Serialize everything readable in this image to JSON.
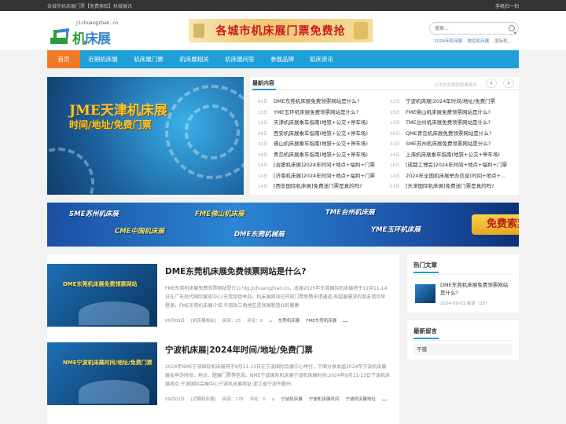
{
  "topbar": {
    "notice": "各城市机床展门票【免费索取】机械展讯",
    "mobile": "手机扫一扫"
  },
  "header": {
    "logo_domain": "jichuangzhan.cn",
    "logo_first": "机",
    "logo_rest": "床展网",
    "banner_text": "各城市机床展门票免费抢",
    "search_placeholder": "搜索...",
    "hotwords": [
      "2024年机床展",
      "数控机床展",
      "国际机..."
    ]
  },
  "nav": {
    "items": [
      "首页",
      "近期机床展",
      "机床展门票",
      "机床展相关",
      "机床展问答",
      "参展品牌",
      "机床资讯"
    ]
  },
  "slider": {
    "line1": "JME天津机床展",
    "line2": "时间/地址/免费门票"
  },
  "latest": {
    "title": "最新内容",
    "tip": "点击左右按钮查看更多",
    "prev": "‹",
    "next": "›",
    "left": [
      {
        "date": "03日",
        "title": "DME东莞机床展免费领票网站是什么?"
      },
      {
        "date": "13日",
        "title": "YME玉环机床展免费领票网站是什么?"
      },
      {
        "date": "13日",
        "title": "天津机床展乘车指南(地铁+公交+停车场)"
      },
      {
        "date": "06日",
        "title": "西安机床展乘车指南(地铁+公交+停车场)"
      },
      {
        "date": "31日",
        "title": "佛山机床展乘车指南(地铁+公交+停车场)"
      },
      {
        "date": "24日",
        "title": "青岛机床展乘车指南(地铁+公交+停车场)"
      },
      {
        "date": "16日",
        "title": "[合肥机床展]2024年时间+地点+福利+门票"
      },
      {
        "date": "14日",
        "title": "[济南机床展]2024年时间+地点+福利+门票"
      },
      {
        "date": "14日",
        "title": "[西安国际机床展]免费送门票是真的吗?"
      }
    ],
    "right": [
      {
        "date": "02日",
        "title": "宁波机床展|2024年时间/地址/免费门票"
      },
      {
        "date": "15日",
        "title": "FME佛山机床展免费领票网站是什么?"
      },
      {
        "date": "13日",
        "title": "TME台州机床展免费领票网站是什么?"
      },
      {
        "date": "06日",
        "title": "QME青岛机床展免费领票网站是什么?"
      },
      {
        "date": "31日",
        "title": "SME苏州机床展免费领票网站是什么?"
      },
      {
        "date": "24日",
        "title": "上海机床展乘车指南(地铁+公交+停车场)"
      },
      {
        "date": "16日",
        "title": "[成都工博会]2024年时间+地点+福利+门票"
      },
      {
        "date": "14日",
        "title": "2024年全国机床展举办信息(时间+地点+..."
      },
      {
        "date": "01日",
        "title": "[天津国际机床展]免费送门票是真的吗?"
      }
    ]
  },
  "ad2": {
    "texts": [
      "SME苏州机床展",
      "FME佛山机床展",
      "TME台州机床展",
      "CME中国机床展",
      "DME东莞机械展",
      "YME玉环机床展"
    ],
    "button": "免费索票"
  },
  "posts": [
    {
      "thumb_caption": "DME东莞机床展免费领票网站",
      "title": "DME东莞机床展免费领票网站是什么?",
      "excerpt": "FME东莞机床展免费领票网站是什么?dg.jichuangzhan.cn。本届2025年东莞国际机床展将于11月11-14日在广东现代国际展览中心(东莞厚街举办。机床展网站已开放门票免费申请通道,有超展需求的朋友请尽早登录。FME东莞机床展介绍:华南珠三角地区是我国制造业的聚集",
      "date": "09月03日",
      "category": "[机床展相关]",
      "views": "阅读：25",
      "comments": "评论：0",
      "tags": [
        "东莞机床展",
        "FME东莞机床展"
      ],
      "more": "..."
    },
    {
      "thumb_caption": "NME宁波机床展时间/地址/免费门票",
      "title": "宁波机床展|2024年时间/地址/免费门票",
      "excerpt": "2024年NME宁波国际机床展将于9月11-13日在宁波国际会展中心举行。下面分享本届2024年宁波机床展展会举办时间、地点、题展门票等信息。NME宁波国际机床展宁波机床展时间:2024年9月11-13日宁波机床展地点:宁波国际会展中心宁波机床展地址:浙江省宁波市鄞州",
      "date": "09月02日",
      "category": "[近期机床展]",
      "views": "阅读：176",
      "comments": "评论：0",
      "tags": [
        "宁波机床展",
        "宁波机床展时间",
        "宁波机床展地址"
      ],
      "more": "..."
    }
  ],
  "sidebar": {
    "hot_title": "热门文章",
    "hot_item_title": "DME东莞机床展免费领票网站是什么?",
    "hot_item_meta": "2024-09-03 阅读（25）",
    "comment_title": "最新留言",
    "comment_text": "不错"
  }
}
